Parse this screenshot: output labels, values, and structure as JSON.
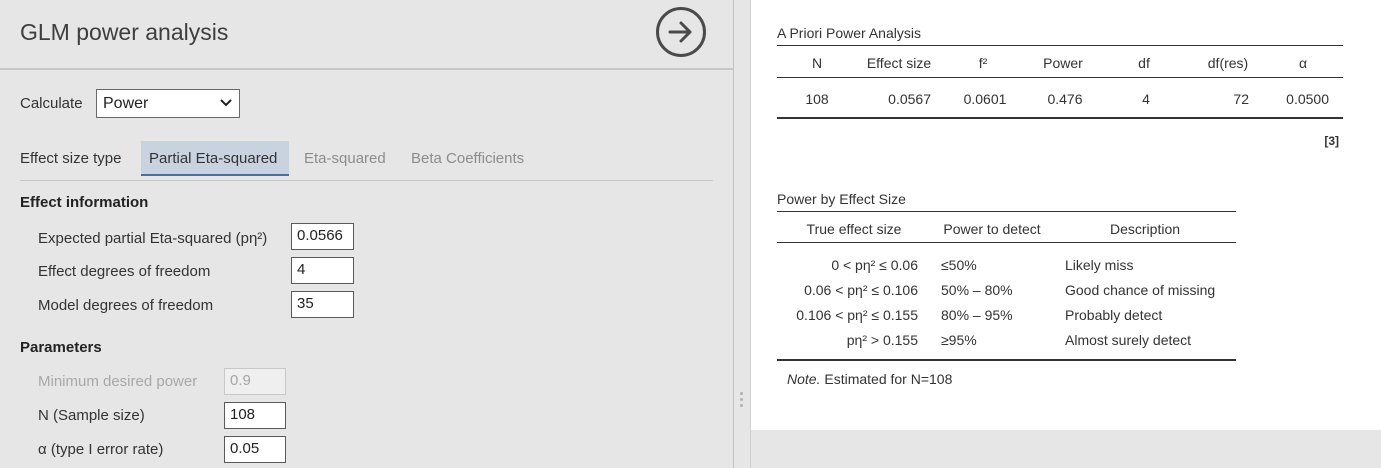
{
  "options": {
    "title": "GLM power analysis",
    "calculate": {
      "label": "Calculate",
      "value": "Power"
    },
    "effect_size_type": {
      "label": "Effect size type",
      "tabs": [
        "Partial Eta-squared",
        "Eta-squared",
        "Beta Coefficients"
      ],
      "active": "Partial Eta-squared"
    },
    "effect_information": {
      "heading": "Effect information",
      "expected_pes_label": "Expected partial Eta-squared (pη²)",
      "expected_pes_value": "0.0566",
      "effect_df_label": "Effect degrees of freedom",
      "effect_df_value": "4",
      "model_df_label": "Model degrees of freedom",
      "model_df_value": "35"
    },
    "parameters": {
      "heading": "Parameters",
      "min_power_label": "Minimum desired power",
      "min_power_value": "0.9",
      "n_label": "N (Sample size)",
      "n_value": "108",
      "alpha_label": "α (type I error rate)",
      "alpha_value": "0.05"
    }
  },
  "results": {
    "apriori": {
      "title": "A Priori Power Analysis",
      "columns": [
        "N",
        "Effect size",
        "f²",
        "Power",
        "df",
        "df(res)",
        "α"
      ],
      "row": [
        "108",
        "0.0567",
        "0.0601",
        "0.476",
        "4",
        "72",
        "0.0500"
      ],
      "footnote": "[3]"
    },
    "power_by_es": {
      "title": "Power by Effect Size",
      "columns": [
        "True effect size",
        "Power to detect",
        "Description"
      ],
      "rows": [
        [
          "0 < pη² ≤ 0.06",
          "≤50%",
          "Likely miss"
        ],
        [
          "0.06 < pη² ≤ 0.106",
          "50% – 80%",
          "Good chance of missing"
        ],
        [
          "0.106 < pη² ≤ 0.155",
          "80% – 95%",
          "Probably detect"
        ],
        [
          "pη² > 0.155",
          "≥95%",
          "Almost surely detect"
        ]
      ],
      "note_label": "Note.",
      "note_text": " Estimated for N=108"
    }
  }
}
